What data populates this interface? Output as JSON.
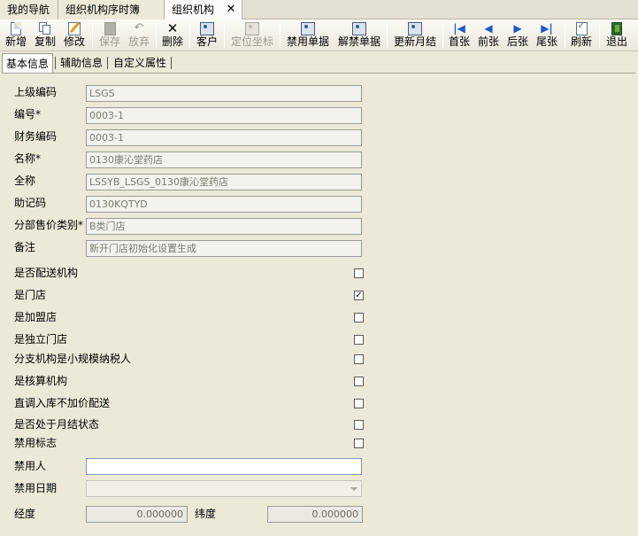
{
  "tabs": [
    {
      "label": "我的导航"
    },
    {
      "label": "组织机构序时簿"
    },
    {
      "label": "组织机构"
    }
  ],
  "tab_close_symbol": "✕",
  "toolbar": {
    "new": "新增",
    "copy": "复制",
    "edit": "修改",
    "save": "保存",
    "discard": "放弃",
    "delete": "删除",
    "customer": "客户",
    "locate": "定位坐标",
    "disable_doc": "禁用单据",
    "undisable_doc": "解禁单据",
    "update_month": "更新月结",
    "first": "首张",
    "prev": "前张",
    "next": "后张",
    "last": "尾张",
    "refresh": "刷新",
    "exit": "退出"
  },
  "subtabs": [
    "基本信息",
    "辅助信息",
    "自定义属性"
  ],
  "form": {
    "parent_code_label": "上级编码",
    "parent_code": "LSGS",
    "code_label": "编号*",
    "code": "0003-1",
    "fin_code_label": "财务编码",
    "fin_code": "0003-1",
    "name_label": "名称*",
    "name": "0130康沁堂药店",
    "full_name_label": "全称",
    "full_name": "LSSYB_LSGS_0130康沁堂药店",
    "mnemonic_label": "助记码",
    "mnemonic": "0130KQTYD",
    "price_cat_label": "分部售价类别*",
    "price_cat": "B类门店",
    "remark_label": "备注",
    "remark": "新开门店初始化设置生成",
    "checks": [
      {
        "label": "是否配送机构",
        "checked": false
      },
      {
        "label": "是门店",
        "checked": true
      },
      {
        "label": "是加盟店",
        "checked": false
      },
      {
        "label": "是独立门店",
        "checked": false
      },
      {
        "label": "分支机构是小规模纳税人",
        "checked": false
      },
      {
        "label": "是核算机构",
        "checked": false
      },
      {
        "label": "直调入库不加价配送",
        "checked": false
      },
      {
        "label": "是否处于月结状态",
        "checked": false
      },
      {
        "label": "禁用标志",
        "checked": false
      }
    ],
    "disabled_by_label": "禁用人",
    "disabled_by": "",
    "disabled_date_label": "禁用日期",
    "disabled_date": "",
    "longitude_label": "经度",
    "longitude": "0.000000",
    "latitude_label": "纬度",
    "latitude": "0.000000"
  }
}
